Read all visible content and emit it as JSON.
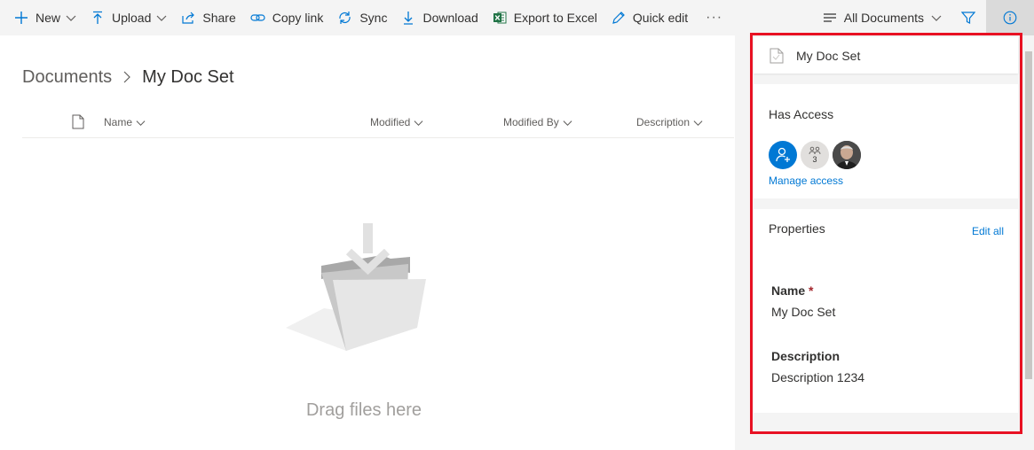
{
  "toolbar": {
    "new_label": "New",
    "upload_label": "Upload",
    "share_label": "Share",
    "copy_link_label": "Copy link",
    "sync_label": "Sync",
    "download_label": "Download",
    "export_label": "Export to Excel",
    "quick_edit_label": "Quick edit",
    "more_label": "···",
    "view_label": "All Documents"
  },
  "breadcrumb": {
    "root": "Documents",
    "current": "My Doc Set"
  },
  "columns": {
    "name": "Name",
    "modified": "Modified",
    "modified_by": "Modified By",
    "description": "Description"
  },
  "empty_state": {
    "text": "Drag files here"
  },
  "details_pane": {
    "title": "My Doc Set",
    "has_access_label": "Has Access",
    "group_count": "3",
    "manage_access_label": "Manage access",
    "properties_label": "Properties",
    "edit_all_label": "Edit all",
    "fields": [
      {
        "label": "Name",
        "required_mark": "*",
        "value": "My Doc Set"
      },
      {
        "label": "Description",
        "value": "Description 1234"
      }
    ]
  },
  "colors": {
    "accent": "#0078d4",
    "highlight": "#e81123",
    "excel_green": "#217346"
  }
}
